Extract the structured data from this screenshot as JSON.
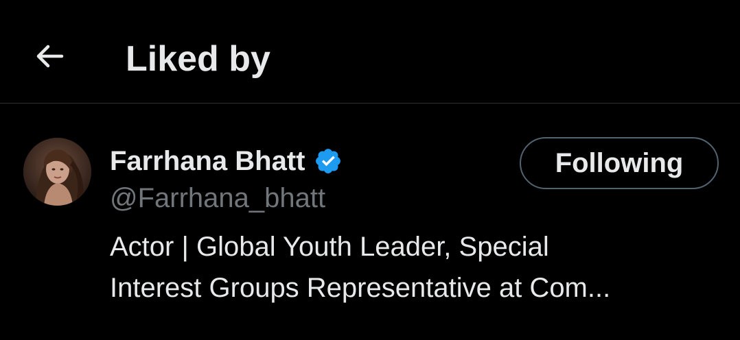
{
  "header": {
    "back_icon": "arrow-left-icon",
    "title": "Liked by"
  },
  "user": {
    "name": "Farrhana Bhatt",
    "verified_icon": "verified-badge-icon",
    "handle": "@Farrhana_bhatt",
    "follow_button_label": "Following",
    "bio_lines": [
      "Actor | Global Youth Leader, Special",
      "Interest Groups Representative at Com..."
    ]
  },
  "colors": {
    "background": "#000000",
    "primary_text": "#e7e9ea",
    "secondary_text": "#71767b",
    "divider": "#2f3336",
    "button_border": "#536471",
    "verified_blue": "#1d9bf0"
  }
}
